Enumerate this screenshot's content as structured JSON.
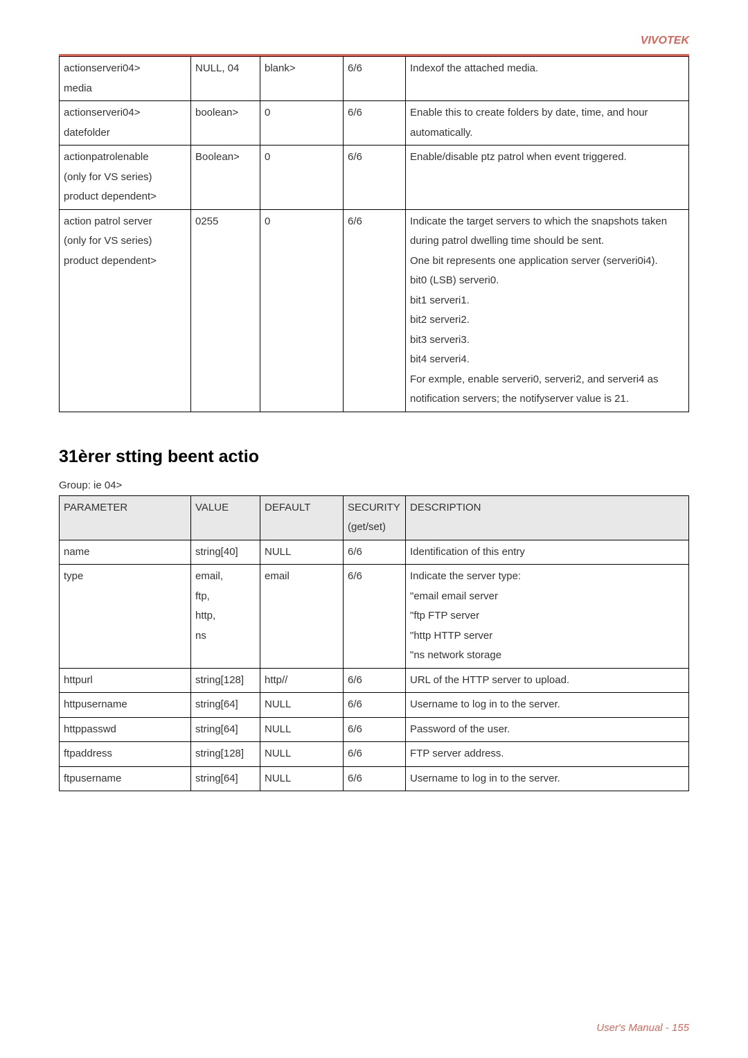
{
  "brand": "VIVOTEK",
  "footer": "User's Manual - 155",
  "table1": {
    "rows": [
      {
        "param": "actionserveri04>\nmedia",
        "value": "NULL, 04",
        "default": "blank>",
        "security": "6/6",
        "desc": "Indexof the attached media."
      },
      {
        "param": "actionserveri04>\ndatefolder",
        "value": "boolean>",
        "default": "0",
        "security": "6/6",
        "desc": "Enable this to create folders by date, time, and hour automatically."
      },
      {
        "param": "actionpatrolenable\n(only for VS series)\nproduct dependent>",
        "value": "Boolean>",
        "default": "0",
        "security": "6/6",
        "desc": "Enable/disable ptz patrol when event triggered."
      },
      {
        "param": "action patrol server\n(only for VS series)\nproduct dependent>",
        "value": "0255",
        "default": "0",
        "security": "6/6",
        "desc": "Indicate the target servers to which the snapshots taken during patrol dwelling time should be sent.\nOne bit represents one application server (serveri0i4).\nbit0 (LSB)  serveri0.\nbit1  serveri1.\nbit2  serveri2.\nbit3  serveri3.\nbit4  serveri4.\nFor exmple, enable serveri0, serveri2, and serveri4 as notification servers; the notifyserver value is 21."
      }
    ]
  },
  "section": {
    "title": "31èrer stting beent actio",
    "group": "Group:   ie           04>"
  },
  "table2": {
    "headers": {
      "param": "PARAMETER",
      "value": "VALUE",
      "default": "DEFAULT",
      "security": "SECURITY (get/set)",
      "desc": "DESCRIPTION"
    },
    "rows": [
      {
        "param": "name",
        "value": "string[40]",
        "default": "NULL",
        "security": "6/6",
        "desc": "Identification of this entry"
      },
      {
        "param": "type",
        "value": "email,\nftp,\nhttp,\nns",
        "default": "email",
        "security": "6/6",
        "desc": "Indicate the server type:\n\"email  email server\n\"ftp  FTP server\n\"http  HTTP server\n\"ns  network storage"
      },
      {
        "param": "httpurl",
        "value": "string[128]",
        "default": "http//",
        "security": "6/6",
        "desc": "URL of the HTTP server to upload."
      },
      {
        "param": "httpusername",
        "value": "string[64]",
        "default": "NULL",
        "security": "6/6",
        "desc": "Username to log in to the server."
      },
      {
        "param": "httppasswd",
        "value": "string[64]",
        "default": "NULL",
        "security": "6/6",
        "desc": "Password of the user."
      },
      {
        "param": "ftpaddress",
        "value": "string[128]",
        "default": "NULL",
        "security": "6/6",
        "desc": "FTP server address."
      },
      {
        "param": "ftpusername",
        "value": "string[64]",
        "default": "NULL",
        "security": "6/6",
        "desc": "Username to log in to the server."
      }
    ]
  }
}
